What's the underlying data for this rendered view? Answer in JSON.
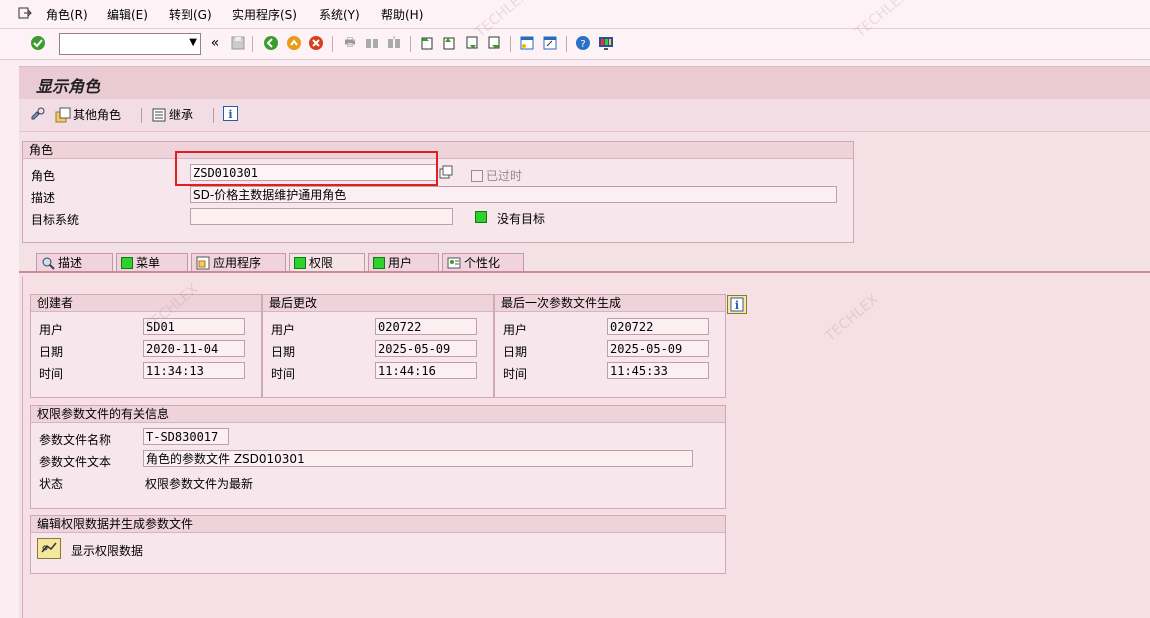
{
  "menu": [
    "角色(R)",
    "编辑(E)",
    "转到(G)",
    "实用程序(S)",
    "系统(Y)",
    "帮助(H)"
  ],
  "page_title": "显示角色",
  "app_toolbar": {
    "other_role": "其他角色",
    "inherit": "继承"
  },
  "role_group": {
    "title": "角色",
    "role_label": "角色",
    "role_value": "ZSD010301",
    "obsolete_label": "已过时",
    "desc_label": "描述",
    "desc_value": "SD-价格主数据维护通用角色",
    "target_label": "目标系统",
    "target_value": "",
    "no_target": "没有目标"
  },
  "tabs": [
    "描述",
    "菜单",
    "应用程序",
    "权限",
    "用户",
    "个性化"
  ],
  "created": {
    "title": "创建者",
    "user_label": "用户",
    "user": "SD01",
    "date_label": "日期",
    "date": "2020-11-04",
    "time_label": "时间",
    "time": "11:34:13"
  },
  "changed": {
    "title": "最后更改",
    "user_label": "用户",
    "user": "020722",
    "date_label": "日期",
    "date": "2025-05-09",
    "time_label": "时间",
    "time": "11:44:16"
  },
  "generated": {
    "title": "最后一次参数文件生成",
    "user_label": "用户",
    "user": "020722",
    "date_label": "日期",
    "date": "2025-05-09",
    "time_label": "时间",
    "time": "11:45:33"
  },
  "profile_info": {
    "title": "权限参数文件的有关信息",
    "name_label": "参数文件名称",
    "name": "T-SD830017",
    "text_label": "参数文件文本",
    "text": "角色的参数文件 ZSD010301",
    "status_label": "状态",
    "status": "权限参数文件为最新"
  },
  "edit_group": {
    "title": "编辑权限数据并生成参数文件",
    "show_label": "显示权限数据"
  },
  "colors": {
    "highlight_box": "#e02020",
    "status_green": "#2fd12f",
    "background": "#fbeef2"
  }
}
